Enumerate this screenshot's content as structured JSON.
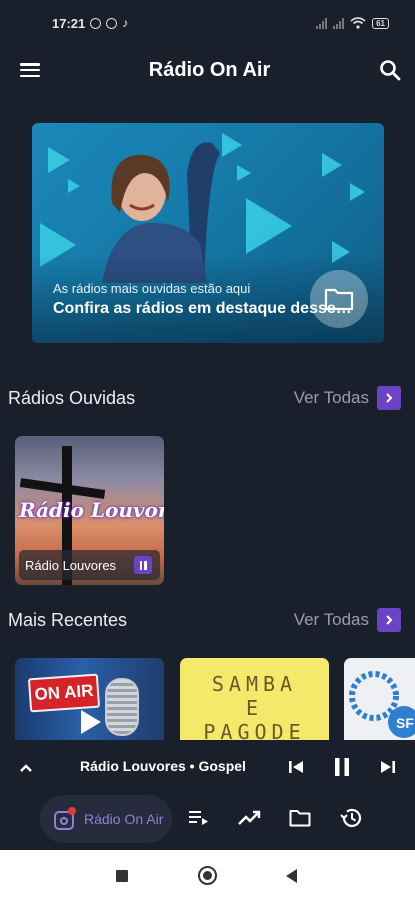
{
  "status_bar": {
    "time": "17:21",
    "battery": "61"
  },
  "header": {
    "title": "Rádio On Air"
  },
  "banner": {
    "subtitle": "As rádios mais ouvidas estão aqui",
    "title": "Confira as rádios em destaque desse…"
  },
  "sections": {
    "listened": {
      "title": "Rádios Ouvidas",
      "see_all": "Ver Todas"
    },
    "recent": {
      "title": "Mais Recentes",
      "see_all": "Ver Todas"
    }
  },
  "listened_card": {
    "logo_text": "Rádio Louvores",
    "name": "Rádio Louvores"
  },
  "recent_items": {
    "first_badge": "ON AIR",
    "second_text": "SAMBA\nE\nPAGODE"
  },
  "mini_player": {
    "title": "Rádio Louvores • Gospel"
  },
  "bottom_nav": {
    "active_label": "Rádio On Air"
  },
  "colors": {
    "background": "#1a1f2c",
    "accent": "#6a44c4",
    "active_text": "#8f7fd8"
  }
}
